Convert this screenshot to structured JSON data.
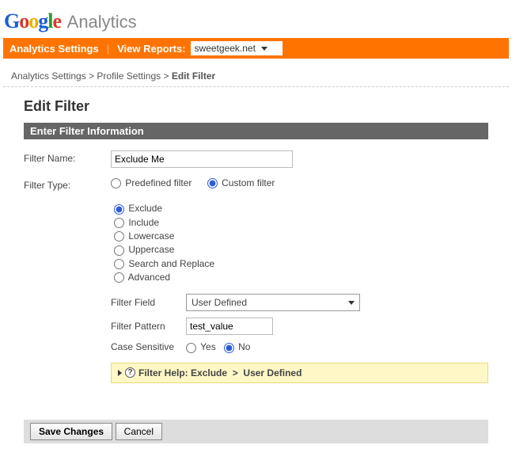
{
  "logo": {
    "google": "Google",
    "analytics": "Analytics"
  },
  "nav": {
    "settings": "Analytics Settings",
    "reports_label": "View Reports:",
    "site_selected": "sweetgeek.net"
  },
  "breadcrumb": {
    "a": "Analytics Settings",
    "b": "Profile Settings",
    "current": "Edit Filter",
    "sep": ">"
  },
  "page_title": "Edit Filter",
  "section_title": "Enter Filter Information",
  "form": {
    "filter_name_label": "Filter Name:",
    "filter_name_value": "Exclude Me",
    "filter_type_label": "Filter Type:",
    "type_options": {
      "predefined": "Predefined filter",
      "custom": "Custom filter"
    },
    "custom_options": {
      "exclude": "Exclude",
      "include": "Include",
      "lowercase": "Lowercase",
      "uppercase": "Uppercase",
      "search_replace": "Search and Replace",
      "advanced": "Advanced"
    },
    "filter_field_label": "Filter Field",
    "filter_field_value": "User Defined",
    "filter_pattern_label": "Filter Pattern",
    "filter_pattern_value": "test_value",
    "case_sensitive_label": "Case Sensitive",
    "cs_yes": "Yes",
    "cs_no": "No"
  },
  "help": {
    "prefix": "Filter Help:",
    "mode": "Exclude",
    "sep": ">",
    "field": "User Defined"
  },
  "buttons": {
    "save": "Save Changes",
    "cancel": "Cancel"
  }
}
